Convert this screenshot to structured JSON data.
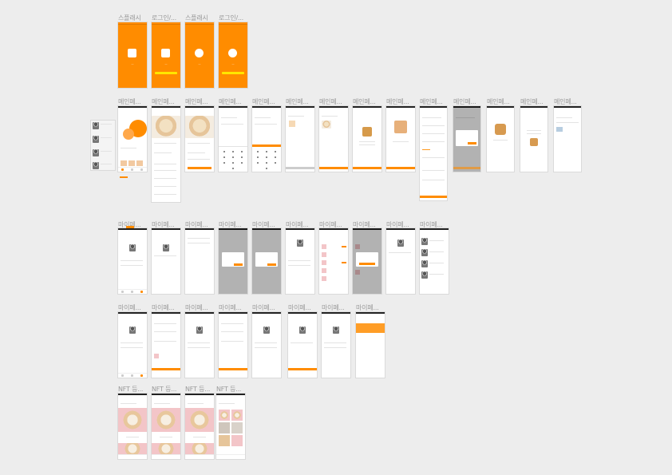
{
  "canvas": {
    "background": "#ededed",
    "accent": "#ff8c00",
    "highlight": "#ffe600"
  },
  "rows": {
    "splash": {
      "labels": [
        "스플래시",
        "로그인/...",
        "스플래시",
        "로그인/..."
      ],
      "icons": [
        "cat-logo-icon",
        "cat-logo-icon",
        "dog-logo-icon",
        "dog-logo-icon"
      ]
    },
    "main": {
      "labels": [
        "메인페...",
        "메인페...",
        "메인페...",
        "메인페...",
        "메인페...",
        "메인페...",
        "메인페...",
        "메인페...",
        "메인페...",
        "메인페...",
        "메인페...",
        "메인페...",
        "메인페...",
        "메인페..."
      ]
    },
    "mypage_a": {
      "labels": [
        "마이페...",
        "마이페...",
        "마이페...",
        "마이페...",
        "마이페...",
        "마이페...",
        "마이페...",
        "마이페...",
        "마이페...",
        "마이페..."
      ]
    },
    "mypage_b": {
      "labels": [
        "마이페...",
        "마이페...",
        "마이페...",
        "마이페...",
        "마이페...",
        "마이페...",
        "마이페...",
        "마이페..."
      ]
    },
    "nft": {
      "labels": [
        "NFT 등...",
        "NFT 등...",
        "NFT 등...",
        "NFT 등..."
      ]
    }
  }
}
